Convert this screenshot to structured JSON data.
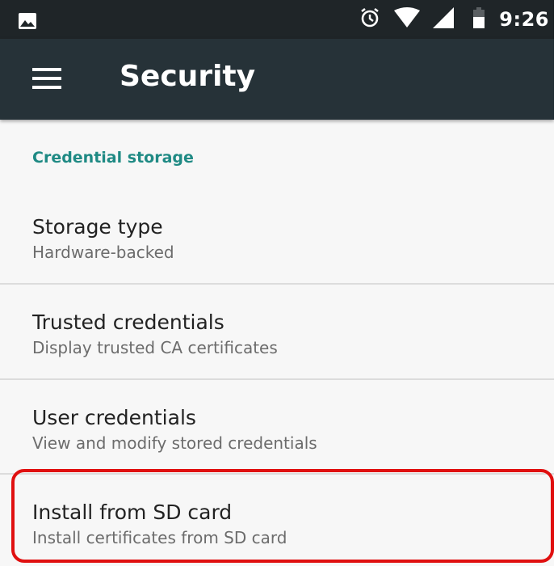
{
  "status_bar": {
    "time": "9:26",
    "icons": [
      "image-icon",
      "alarm-icon",
      "wifi-icon",
      "signal-icon",
      "battery-icon"
    ]
  },
  "toolbar": {
    "title": "Security",
    "menu_icon": "menu-icon"
  },
  "section": {
    "header": "Credential storage"
  },
  "items": [
    {
      "title": "Storage type",
      "summary": "Hardware-backed"
    },
    {
      "title": "Trusted credentials",
      "summary": "Display trusted CA certificates"
    },
    {
      "title": "User credentials",
      "summary": "View and modify stored credentials"
    },
    {
      "title": "Install from SD card",
      "summary": "Install certificates from SD card"
    }
  ],
  "colors": {
    "status_bar_bg": "#1f2528",
    "toolbar_bg": "#263238",
    "accent": "#1f8a84",
    "highlight": "#e01010"
  }
}
